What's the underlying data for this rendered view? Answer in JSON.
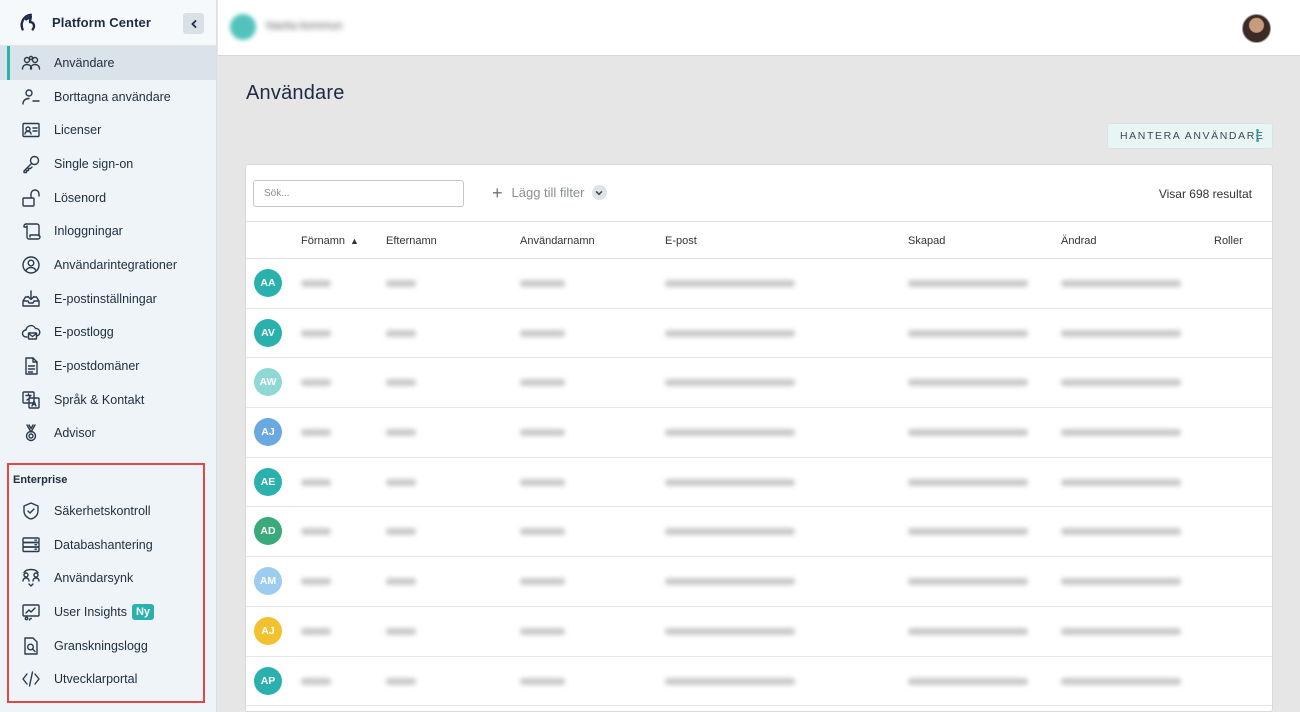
{
  "app": {
    "title": "Platform Center"
  },
  "sidebar": {
    "items": [
      {
        "label": "Användare",
        "icon": "users-icon",
        "name": "sidebar-item-users",
        "active": true
      },
      {
        "label": "Borttagna användare",
        "icon": "user-minus-icon",
        "name": "sidebar-item-deleted-users"
      },
      {
        "label": "Licenser",
        "icon": "id-card-icon",
        "name": "sidebar-item-licenses"
      },
      {
        "label": "Single sign-on",
        "icon": "key-icon",
        "name": "sidebar-item-sso"
      },
      {
        "label": "Lösenord",
        "icon": "unlock-icon",
        "name": "sidebar-item-password"
      },
      {
        "label": "Inloggningar",
        "icon": "scroll-icon",
        "name": "sidebar-item-logins"
      },
      {
        "label": "Användarintegrationer",
        "icon": "user-circle-icon",
        "name": "sidebar-item-user-integrations"
      },
      {
        "label": "E-postinställningar",
        "icon": "inbox-download-icon",
        "name": "sidebar-item-email-settings"
      },
      {
        "label": "E-postlogg",
        "icon": "cloud-mail-icon",
        "name": "sidebar-item-email-log"
      },
      {
        "label": "E-postdomäner",
        "icon": "document-icon",
        "name": "sidebar-item-email-domains"
      },
      {
        "label": "Språk & Kontakt",
        "icon": "language-icon",
        "name": "sidebar-item-language-contact"
      },
      {
        "label": "Advisor",
        "icon": "medal-icon",
        "name": "sidebar-item-advisor"
      }
    ],
    "enterprise": {
      "heading": "Enterprise",
      "items": [
        {
          "label": "Säkerhetskontroll",
          "icon": "shield-check-icon",
          "name": "sidebar-item-security-check"
        },
        {
          "label": "Databashantering",
          "icon": "database-icon",
          "name": "sidebar-item-database"
        },
        {
          "label": "Användarsynk",
          "icon": "user-sync-icon",
          "name": "sidebar-item-user-sync"
        },
        {
          "label": "User Insights",
          "icon": "insights-icon",
          "name": "sidebar-item-user-insights",
          "badge": "Ny"
        },
        {
          "label": "Granskningslogg",
          "icon": "audit-log-icon",
          "name": "sidebar-item-audit-log"
        },
        {
          "label": "Utvecklarportal",
          "icon": "code-icon",
          "name": "sidebar-item-developer-portal"
        }
      ]
    }
  },
  "page": {
    "title": "Användare",
    "manage_label": "HANTERA ANVÄNDARE"
  },
  "filters": {
    "search_placeholder": "Sök...",
    "add_filter_label": "Lägg till filter",
    "results_text": "Visar 698 resultat"
  },
  "table": {
    "columns": [
      "Förnamn",
      "Efternamn",
      "Användarnamn",
      "E-post",
      "Skapad",
      "Ändrad",
      "Roller"
    ],
    "rows": [
      {
        "initials": "AA",
        "color": "#2bb1ad"
      },
      {
        "initials": "AV",
        "color": "#2bb1ad"
      },
      {
        "initials": "AW",
        "color": "#8fd8d3"
      },
      {
        "initials": "AJ",
        "color": "#6aa8e0"
      },
      {
        "initials": "AE",
        "color": "#2bb1ad"
      },
      {
        "initials": "AD",
        "color": "#3aaa7a"
      },
      {
        "initials": "AM",
        "color": "#9ccdf0"
      },
      {
        "initials": "AJ",
        "color": "#f2c12e"
      },
      {
        "initials": "AP",
        "color": "#2bb1ad"
      }
    ]
  },
  "colors": {
    "accent": "#2bb1ad",
    "highlight_border": "#e04848"
  }
}
